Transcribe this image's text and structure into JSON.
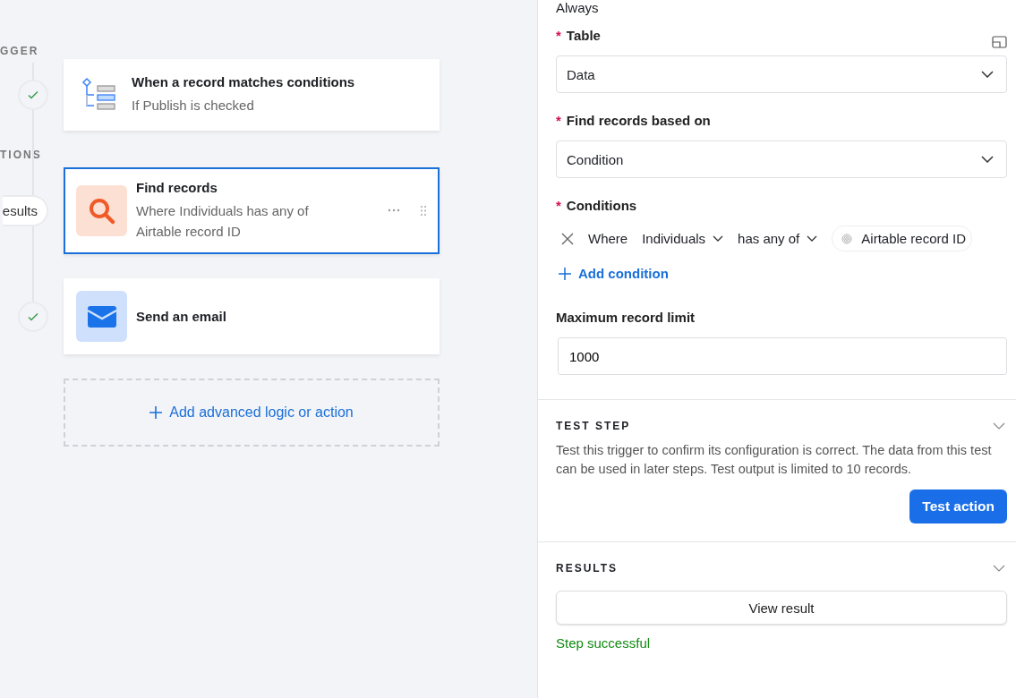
{
  "canvas": {
    "sections": [
      {
        "label": "GGER",
        "steps": [
          {
            "kind": "trigger",
            "checked": true,
            "selected": false,
            "title": "When a record matches conditions",
            "subtitle": "If Publish is checked"
          }
        ]
      },
      {
        "label": "TIONS",
        "steps": [
          {
            "kind": "find",
            "checked": false,
            "badge": "esults",
            "selected": true,
            "title": "Find records",
            "subtitle": "Where Individuals has any of Airtable record ID"
          },
          {
            "kind": "email",
            "checked": true,
            "selected": false,
            "title": "Send an email"
          }
        ]
      }
    ],
    "add_button": "Add advanced logic or action"
  },
  "panel": {
    "top_text": "Always",
    "table": {
      "label": "Table",
      "required_mark": "*",
      "value": "Data"
    },
    "based_on": {
      "label": "Find records based on",
      "required_mark": "*",
      "value": "Condition"
    },
    "conditions": {
      "label": "Conditions",
      "required_mark": "*",
      "rows": [
        {
          "prefix": "Where",
          "field": "Individuals",
          "operator": "has any of",
          "value": "Airtable record ID"
        }
      ],
      "add": "Add condition"
    },
    "limit": {
      "label": "Maximum record limit",
      "value": "1000"
    },
    "test_step": {
      "heading": "TEST STEP",
      "text": "Test this trigger to confirm its configuration is correct. The data from this test can be used in later steps. Test output is limited to 10 records.",
      "button": "Test action"
    },
    "results": {
      "heading": "RESULTS",
      "button": "View result",
      "status": "Step successful"
    }
  }
}
